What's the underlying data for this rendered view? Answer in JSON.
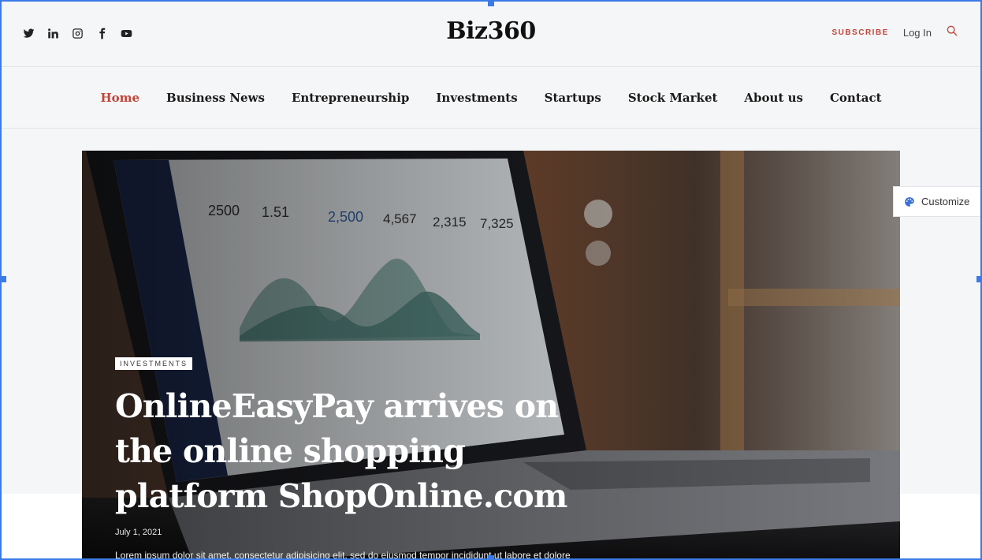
{
  "header": {
    "social": [
      {
        "icon": "twitter-icon"
      },
      {
        "icon": "linkedin-icon"
      },
      {
        "icon": "instagram-icon"
      },
      {
        "icon": "facebook-icon"
      },
      {
        "icon": "youtube-icon"
      }
    ],
    "logo": "Biz360",
    "subscribe": "SUBSCRIBE",
    "login": "Log In",
    "search_icon": "search-icon"
  },
  "nav": {
    "items": [
      {
        "label": "Home"
      },
      {
        "label": "Business News"
      },
      {
        "label": "Entrepreneurship"
      },
      {
        "label": "Investments"
      },
      {
        "label": "Startups"
      },
      {
        "label": "Stock Market"
      },
      {
        "label": "About us"
      },
      {
        "label": "Contact"
      }
    ],
    "active_color": "#c0453a"
  },
  "hero": {
    "category": "INVESTMENTS",
    "title": "OnlineEasyPay arrives on the online shopping platform ShopOnline.com",
    "date": "July 1, 2021",
    "excerpt": "Lorem ipsum dolor sit amet, consectetur adipisicing elit, sed do eiusmod tempor incididunt ut labore et dolore",
    "dashboard_stats": [
      "2500",
      "1.51",
      "2,500",
      "4,567",
      "2,315",
      "7,325"
    ]
  },
  "customize": {
    "label": "Customize",
    "icon": "palette-icon"
  },
  "colors": {
    "accent": "#c0453a",
    "selection": "#3b7be8",
    "page_bg": "#f5f6f8"
  }
}
